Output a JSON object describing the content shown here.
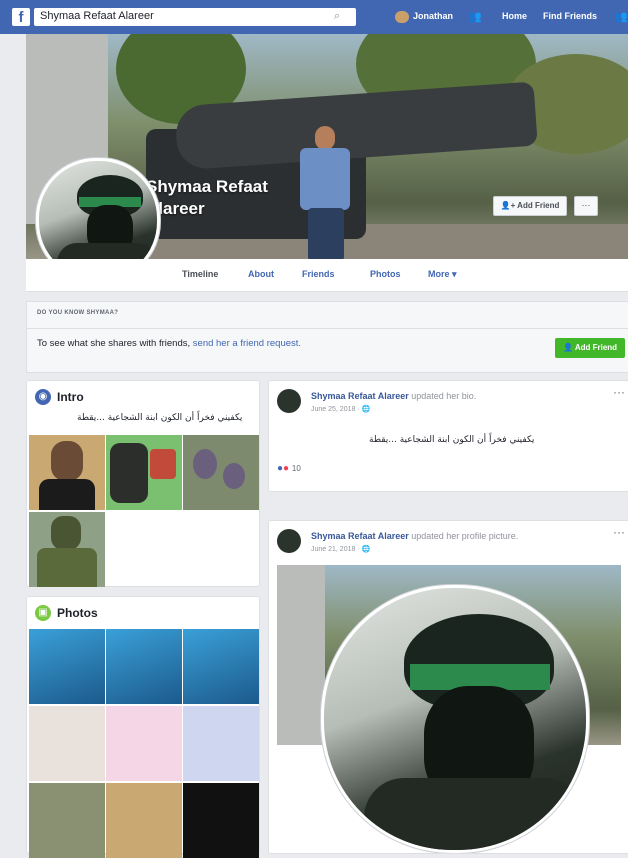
{
  "topbar": {
    "logo": "f",
    "search_value": "Shymaa Refaat Alareer",
    "search_icon": "magnifier",
    "user_name": "Jonathan",
    "home": "Home",
    "find_friends": "Find Friends"
  },
  "cover": {
    "name_line1": "Shymaa Refaat",
    "name_line2": "Alareer",
    "add_friend": "Add Friend",
    "more": "···"
  },
  "tabs": [
    {
      "label": "Timeline"
    },
    {
      "label": "About"
    },
    {
      "label": "Friends"
    },
    {
      "label": "Photos"
    },
    {
      "label": "More ▾"
    }
  ],
  "know": {
    "title": "DO YOU KNOW SHYMAA?",
    "text_prefix": "To see what she shares with friends, ",
    "text_link": "send her a friend request.",
    "add_friend": "Add Friend"
  },
  "intro": {
    "title": "Intro",
    "bio": "يكفيني فخراً أن الكون ابنة الشجاعية ...يقطة"
  },
  "photos_card": {
    "title": "Photos"
  },
  "post1": {
    "author": "Shymaa Refaat Alareer",
    "action": " updated her bio.",
    "date": "June 25, 2018 · ",
    "bio": "يكفيني فخراً أن الكون ابنة الشجاعية ...يقطة",
    "reactions": "10"
  },
  "post2": {
    "author": "Shymaa Refaat Alareer",
    "action": " updated her profile picture.",
    "date": "June 21, 2018 · "
  },
  "colors": {
    "brand": "#4267b2",
    "add_green": "#42b72a",
    "link": "#385898"
  }
}
